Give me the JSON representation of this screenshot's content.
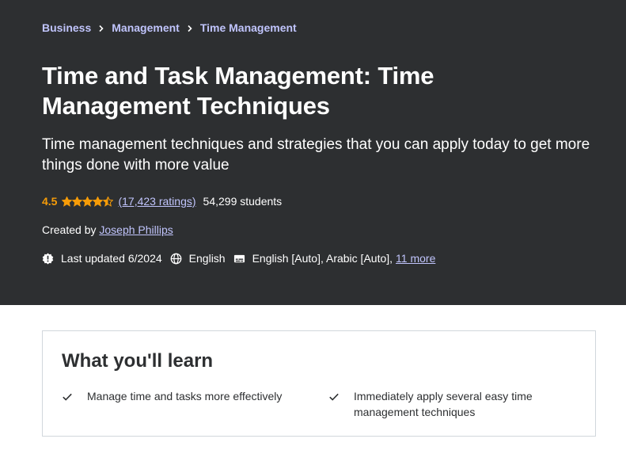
{
  "breadcrumb": {
    "items": [
      "Business",
      "Management",
      "Time Management"
    ]
  },
  "course": {
    "title": "Time and Task Management: Time Management Techniques",
    "subtitle": "Time management techniques and strategies that you can apply today to get more things done with more value",
    "rating": "4.5",
    "stars_value": 4.5,
    "stars_max": 5,
    "ratings_count": "(17,423 ratings)",
    "students": "54,299 students",
    "created_by_label": "Created by",
    "author": "Joseph Phillips",
    "last_updated": "Last updated 6/2024",
    "language": "English",
    "captions": "English [Auto], Arabic [Auto],",
    "captions_more": "11 more"
  },
  "learn": {
    "title": "What you'll learn",
    "items": [
      "Manage time and tasks more effectively",
      "Immediately apply several easy time management techniques"
    ]
  },
  "colors": {
    "hero_bg": "#2d2f31",
    "link": "#c0c4fc",
    "star": "#f69c08"
  },
  "icons": {
    "breadcrumb_separator": "chevron-right-icon",
    "updated": "alert-badge-icon",
    "language": "globe-icon",
    "captions": "closed-captions-icon",
    "learn_item": "check-icon"
  }
}
